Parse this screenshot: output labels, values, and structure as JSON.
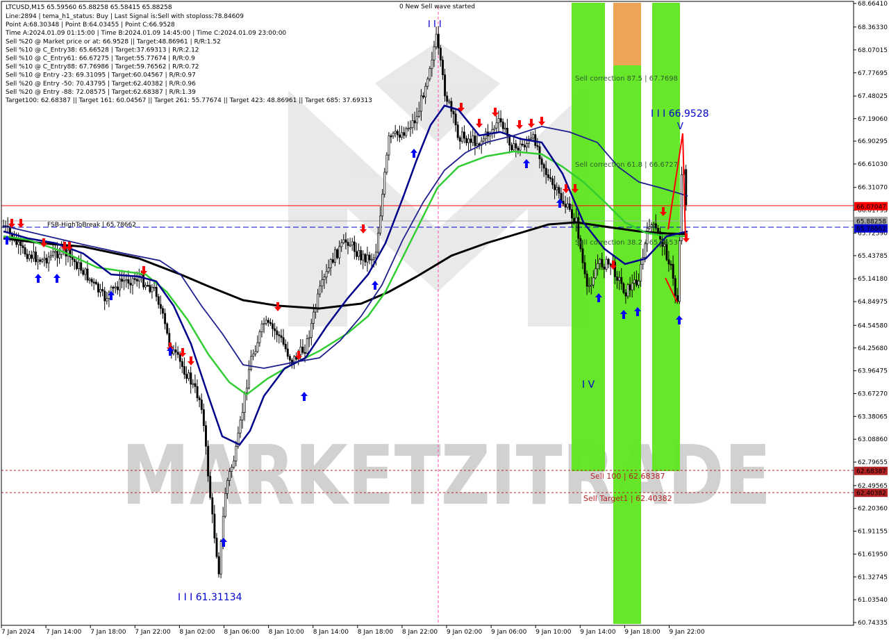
{
  "chart_data": {
    "type": "candlestick",
    "symbol_header": "LTCUSD,M15  65.59560 65.88258 65.58415 65.88258",
    "info_lines": [
      "Line:2894 | tema_h1_status: Buy | Last Signal is:Sell with stoploss:78.84609",
      "Point A:68.30348 | Point B:64.03455 | Point C:66.9528",
      "Time A:2024.01.09 01:15:00 | Time B:2024.01.09 14:45:00 | Time C:2024.01.09 23:00:00",
      "Sell %20 @ Market price or at: 66.9528 || Target:48.86961 | R/R:1.52",
      "Sell %10 @ C_Entry38: 65.66528 | Target:37.69313 | R/R:2.12",
      "Sell %10 @ C_Entry61: 66.67275 | Target:55.77674 | R/R:0.9",
      "Sell %10 @ C_Entry88: 67.76986 | Target:59.76562 | R/R:0.72",
      "Sell %10 @ Entry -23: 69.31095 | Target:60.04567 | R/R:0.97",
      "Sell %20 @ Entry -50: 70.43795 | Target:62.40382 | R/R:0.96",
      "Sell %20 @ Entry -88: 72.08575 | Target:62.68387 | R/R:1.39",
      "Target100: 62.68387 || Target 161: 60.04567 || Target 261: 55.77674 || Target 423: 48.86961 || Target 685: 37.69313"
    ],
    "top_label": "0 New Sell wave started",
    "x_ticks": [
      "7 Jan 2024",
      "7 Jan 14:00",
      "7 Jan 18:00",
      "7 Jan 22:00",
      "8 Jan 02:00",
      "8 Jan 06:00",
      "8 Jan 10:00",
      "8 Jan 14:00",
      "8 Jan 18:00",
      "8 Jan 22:00",
      "9 Jan 02:00",
      "9 Jan 06:00",
      "9 Jan 10:00",
      "9 Jan 14:00",
      "9 Jan 18:00",
      "9 Jan 22:00"
    ],
    "y_ticks": [
      "68.66410",
      "68.36330",
      "68.07015",
      "67.77695",
      "67.48025",
      "67.19060",
      "66.90295",
      "66.61030",
      "66.31070",
      "66.01795",
      "65.72590",
      "65.43785",
      "65.14180",
      "64.84975",
      "64.54580",
      "64.25680",
      "63.96475",
      "63.67270",
      "63.38065",
      "63.08860",
      "62.79655",
      "62.49565",
      "62.20360",
      "61.91155",
      "61.61950",
      "61.32745",
      "61.03540",
      "60.74335"
    ],
    "y_range": [
      60.74335,
      68.6641
    ],
    "price_tags": [
      {
        "label": "66.07047",
        "value": 66.07047,
        "color": "#ff0000"
      },
      {
        "label": "65.88258",
        "value": 65.88258,
        "color": "#a8a8a8"
      },
      {
        "label": "65.78662",
        "value": 65.78662,
        "color": "#0000cd"
      },
      {
        "label": "62.68387",
        "value": 62.68387,
        "color": "#b22222"
      },
      {
        "label": "62.40382",
        "value": 62.40382,
        "color": "#b22222"
      }
    ],
    "annotations": {
      "fsb_label": "FSB-HighToBreak | 65.78662",
      "sell_correction_875": "Sell correction 87.5 | 67.7698",
      "sell_correction_618": "Sell correction 61.8 | 66.6727",
      "sell_correction_382": "Sell correction 38.2 | 65.6653",
      "sell_100": "Sell 100 | 62.68387",
      "sell_target1": "Sell Target1 | 62.40382",
      "wave_iii_label": "I I I",
      "wave_iii_value": "I I I 66.9528",
      "wave_v": "V",
      "wave_iv": "I V",
      "wave_low": "I I I 61.31134"
    },
    "watermark": "MARKETZITRADE",
    "colors": {
      "ma_green": "#32cd32",
      "ma_navy": "#00008b",
      "ma_dark": "#1e1e8c",
      "ma_black": "#000000",
      "zone_green": "#5ee61e",
      "zone_orange": "#f5a05a",
      "sell_arrow": "#ff0000",
      "buy_arrow": "#0000ff"
    }
  }
}
